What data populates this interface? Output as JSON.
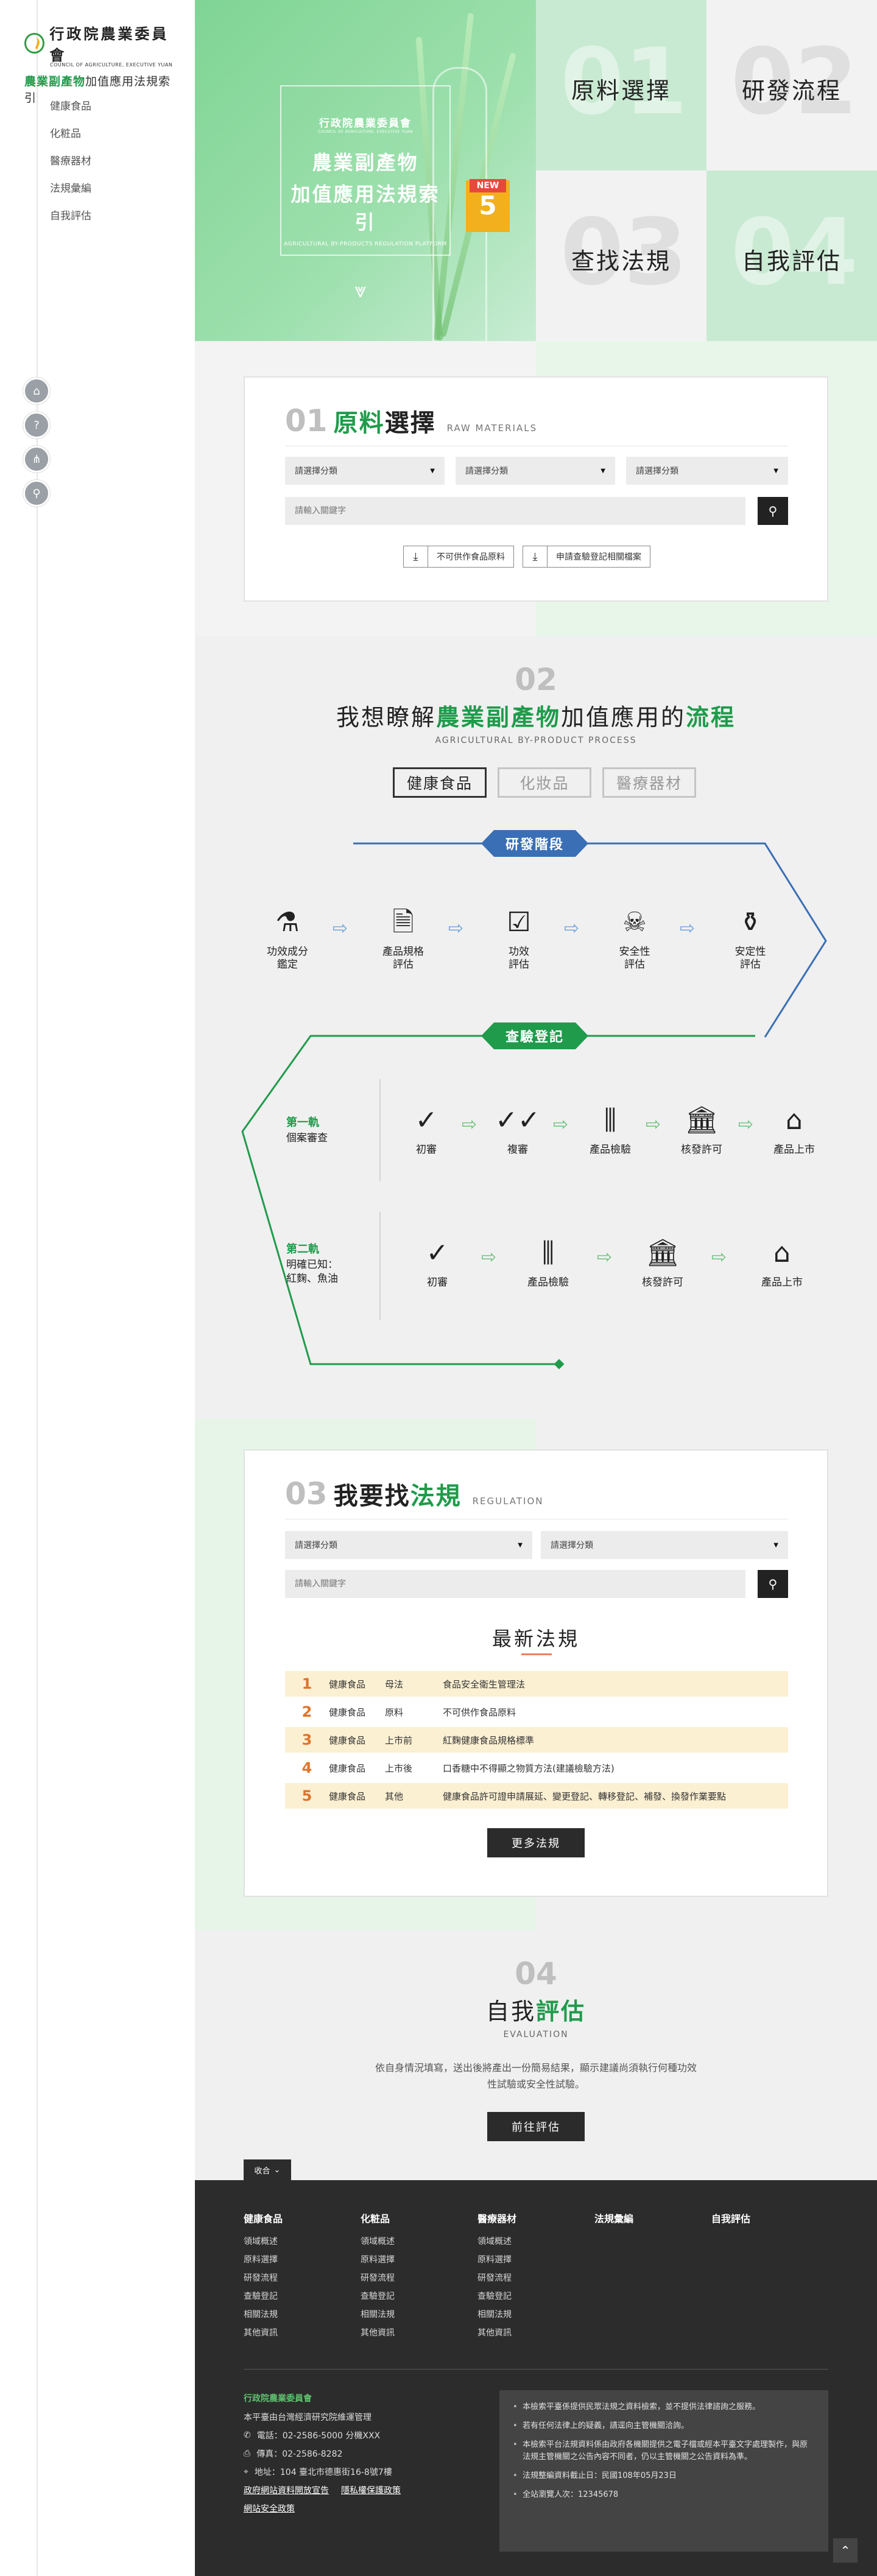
{
  "logo": {
    "org_cn": "行政院農業委員會",
    "org_en": "COUNCIL OF AGRICULTURE, EXECUTIVE YUAN",
    "site_green": "農業副產物",
    "site_rest": "加值應用法規索引"
  },
  "sidebar": {
    "items": [
      {
        "label": "健康食品"
      },
      {
        "label": "化粧品"
      },
      {
        "label": "醫療器材"
      },
      {
        "label": "法規彙編"
      },
      {
        "label": "自我評估"
      }
    ],
    "icons": [
      "home-icon",
      "help-icon",
      "sitemap-icon",
      "search-icon"
    ]
  },
  "hero": {
    "org_cn": "行政院農業委員會",
    "org_en": "COUNCIL OF AGRICULTURE, EXECUTIVE YUAN",
    "title_line1": "農業副產物",
    "title_line2": "加值應用法規索引",
    "title_en": "AGRICULTURAL BY-PRODUCTS REGULATION PLATFORM"
  },
  "tiles": [
    {
      "num": "01",
      "label": "原料選擇"
    },
    {
      "num": "02",
      "label": "研發流程"
    },
    {
      "num": "03",
      "label": "查找法規"
    },
    {
      "num": "04",
      "label": "自我評估"
    }
  ],
  "new_badge": {
    "label": "NEW",
    "count": "5"
  },
  "raw": {
    "num": "01",
    "title_green": "原料",
    "title_rest": "選擇",
    "title_en": "RAW MATERIALS",
    "selects": [
      "請選擇分類",
      "請選擇分類",
      "請選擇分類"
    ],
    "input_placeholder": "請輸入關鍵字",
    "downloads": [
      "不可供作食品原料",
      "申請查驗登記相關檔案"
    ]
  },
  "process": {
    "num": "02",
    "title_a": "我想瞭解",
    "title_green": "農業副產物",
    "title_b": "加值應用的",
    "title_green2": "流程",
    "title_en": "AGRICULTURAL BY-PRODUCT PROCESS",
    "tabs": [
      "健康食品",
      "化妝品",
      "醫療器材"
    ],
    "stage1": "研發階段",
    "stage1_steps": [
      {
        "l1": "功效成分",
        "l2": "鑑定",
        "icon": "microscope-icon"
      },
      {
        "l1": "產品規格",
        "l2": "評估",
        "icon": "document-alert-icon"
      },
      {
        "l1": "功效",
        "l2": "評估",
        "icon": "checklist-icon"
      },
      {
        "l1": "安全性",
        "l2": "評估",
        "icon": "skull-icon"
      },
      {
        "l1": "安定性",
        "l2": "評估",
        "icon": "flask-icon"
      }
    ],
    "stage2": "查驗登記",
    "track1": {
      "title": "第一軌",
      "desc1": "個案審查",
      "desc2": "",
      "steps": [
        {
          "label": "初審",
          "icon": "check-icon"
        },
        {
          "label": "複審",
          "icon": "double-check-icon"
        },
        {
          "label": "產品檢驗",
          "icon": "test-tubes-icon"
        },
        {
          "label": "核發許可",
          "icon": "government-icon"
        },
        {
          "label": "產品上市",
          "icon": "store-icon"
        }
      ]
    },
    "track2": {
      "title": "第二軌",
      "desc1": "明確已知：",
      "desc2": "紅麴、魚油",
      "steps": [
        {
          "label": "初審",
          "icon": "check-icon"
        },
        {
          "label": "產品檢驗",
          "icon": "test-tubes-icon"
        },
        {
          "label": "核發許可",
          "icon": "government-icon"
        },
        {
          "label": "產品上市",
          "icon": "store-icon"
        }
      ]
    },
    "colors": {
      "blue": "#3a6fb5",
      "green": "#1f9b4b",
      "arrow_blue": "#6fa4dd",
      "arrow_green": "#6cc27c"
    }
  },
  "regulation": {
    "num": "03",
    "title_a": "我要找",
    "title_green": "法規",
    "title_en": "REGULATION",
    "selects": [
      "請選擇分類",
      "請選擇分類"
    ],
    "input_placeholder": "請輸入關鍵字",
    "latest_title": "最新法規",
    "rows": [
      {
        "rank": "1",
        "cat": "健康食品",
        "type": "母法",
        "name": "食品安全衛生管理法"
      },
      {
        "rank": "2",
        "cat": "健康食品",
        "type": "原料",
        "name": "不可供作食品原料"
      },
      {
        "rank": "3",
        "cat": "健康食品",
        "type": "上市前",
        "name": "紅麴健康食品規格標準"
      },
      {
        "rank": "4",
        "cat": "健康食品",
        "type": "上市後",
        "name": "口香糖中不得顯之物質方法(建議檢驗方法)"
      },
      {
        "rank": "5",
        "cat": "健康食品",
        "type": "其他",
        "name": "健康食品許可證申請展延、變更登記、轉移登記、補發、換發作業要點"
      }
    ],
    "more": "更多法規"
  },
  "evaluation": {
    "num": "04",
    "title_a": "自我",
    "title_green": "評估",
    "title_en": "EVALUATION",
    "desc1": "依自身情況填寫，送出後將產出一份簡易結果，顯示建議尚須執行何種功效",
    "desc2": "性試驗或安全性試驗。",
    "button": "前往評估"
  },
  "footer": {
    "collapse": "收合",
    "columns": [
      {
        "title": "健康食品",
        "items": [
          "領域概述",
          "原料選擇",
          "研發流程",
          "查驗登記",
          "相關法規",
          "其他資訊"
        ]
      },
      {
        "title": "化粧品",
        "items": [
          "領域概述",
          "原料選擇",
          "研發流程",
          "查驗登記",
          "相關法規",
          "其他資訊"
        ]
      },
      {
        "title": "醫療器材",
        "items": [
          "領域概述",
          "原料選擇",
          "研發流程",
          "查驗登記",
          "相關法規",
          "其他資訊"
        ]
      },
      {
        "title": "法規彙編",
        "items": []
      },
      {
        "title": "自我評估",
        "items": []
      }
    ],
    "unit_label": "行政院農業委員會",
    "unit_sub": "本平臺由台灣經濟研究院維運管理",
    "phone": "電話：02-2586-5000 分機XXX",
    "fax": "傳真：02-2586-8282",
    "address": "地址：104 臺北市德惠街16-8號7樓",
    "links": [
      "政府網站資料開放宣告",
      "隱私權保護政策",
      "網站安全政策"
    ],
    "notes": [
      "本檢索平臺係提供民眾法規之資料檢索，並不提供法律諮詢之服務。",
      "若有任何法律上的疑義，請逕向主管機關洽詢。",
      "本檢索平台法規資料係由政府各機關提供之電子檔或經本平臺文字處理製作，與原法規主管機關之公告內容不同者，仍以主管機關之公告資料為準。",
      "法規整編資料截止日：民國108年05月23日",
      "全站瀏覽人次：12345678"
    ]
  }
}
